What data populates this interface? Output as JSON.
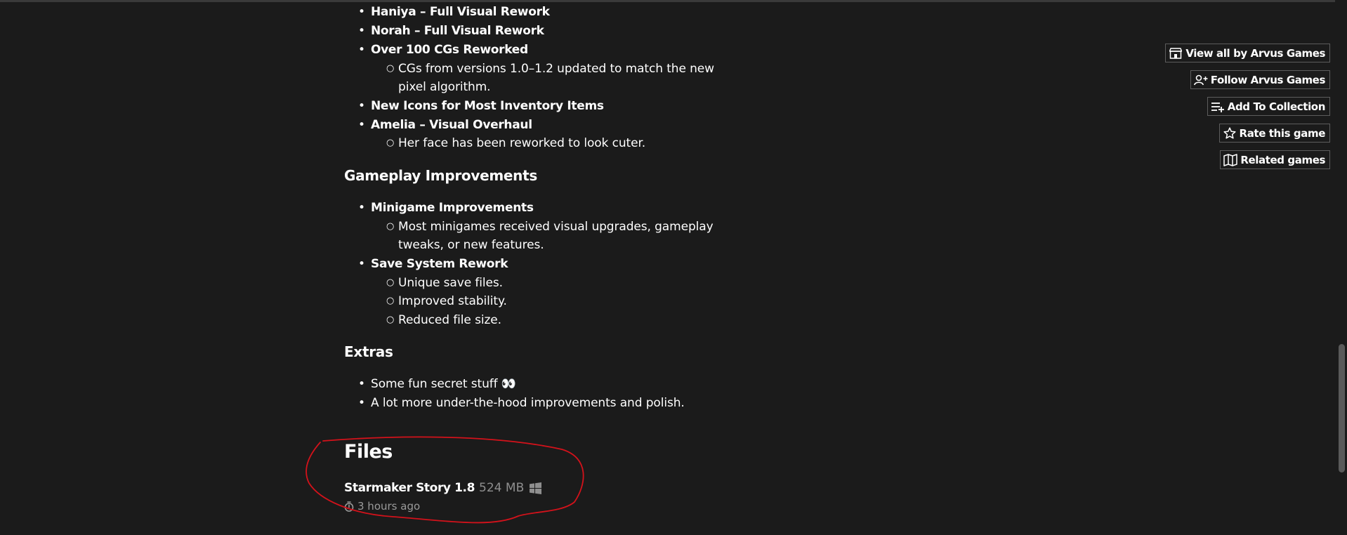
{
  "changelog": {
    "visual_items": [
      {
        "label": "Haniya – Full Visual Rework"
      },
      {
        "label": "Norah – Full Visual Rework"
      },
      {
        "label": "Over 100 CGs Reworked"
      },
      {
        "sub": "CGs from versions 1.0–1.2 updated to match the new"
      },
      {
        "sub": "pixel algorithm."
      },
      {
        "label": "New Icons for Most Inventory Items"
      },
      {
        "label": "Amelia – Visual Overhaul"
      },
      {
        "sub": "Her face has been reworked to look cuter."
      }
    ],
    "gameplay_heading": "Gameplay Improvements",
    "gameplay_items": [
      {
        "label": "Minigame Improvements"
      },
      {
        "sub": "Most minigames received visual upgrades, gameplay"
      },
      {
        "sub": "tweaks, or new features."
      },
      {
        "label": "Save System Rework"
      },
      {
        "sub": "Unique save files."
      },
      {
        "sub": "Improved stability."
      },
      {
        "sub": "Reduced file size."
      }
    ],
    "extras_heading": "Extras",
    "extras_items": [
      {
        "text": "Some fun secret stuff 👀"
      },
      {
        "text": "A lot more under-the-hood improvements and polish."
      }
    ]
  },
  "files": {
    "heading": "Files",
    "file": {
      "name": "Starmaker Story 1.8",
      "size": "524 MB",
      "platform_icon": "windows-icon",
      "date_icon": "stopwatch-icon",
      "uploaded": "3 hours ago"
    }
  },
  "sidebar_buttons": [
    {
      "label": "View all by Arvus Games",
      "icon": "itchio-store-icon"
    },
    {
      "label": "Follow Arvus Games",
      "icon": "add-user-icon"
    },
    {
      "label": "Add To Collection",
      "icon": "add-to-list-icon"
    },
    {
      "label": "Rate this game",
      "icon": "star-icon"
    },
    {
      "label": "Related games",
      "icon": "map-icon"
    }
  ],
  "annotation_color": "#d3121b"
}
